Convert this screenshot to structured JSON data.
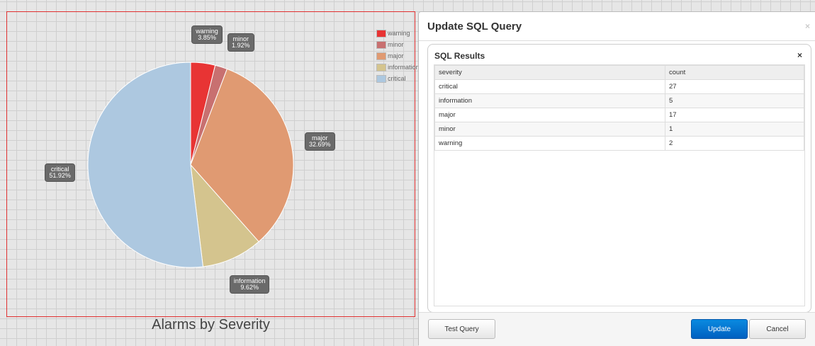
{
  "chart_data": {
    "type": "pie",
    "title": "Alarms by Severity",
    "categories": [
      "warning",
      "minor",
      "major",
      "information",
      "critical"
    ],
    "values": [
      2,
      1,
      17,
      5,
      27
    ],
    "percent_labels": [
      "3.85%",
      "1.92%",
      "32.69%",
      "9.62%",
      "51.92%"
    ],
    "colors": [
      "#e83434",
      "#c87070",
      "#e09a72",
      "#d4c48e",
      "#adc8e0"
    ],
    "legend_position": "top-right"
  },
  "modal": {
    "title": "Update SQL Query",
    "close": "×",
    "panel_title": "SQL Results",
    "panel_close": "×",
    "columns": [
      "severity",
      "count"
    ],
    "rows": [
      [
        "critical",
        "27"
      ],
      [
        "information",
        "5"
      ],
      [
        "major",
        "17"
      ],
      [
        "minor",
        "1"
      ],
      [
        "warning",
        "2"
      ]
    ],
    "buttons": {
      "test": "Test Query",
      "update": "Update",
      "cancel": "Cancel"
    }
  }
}
